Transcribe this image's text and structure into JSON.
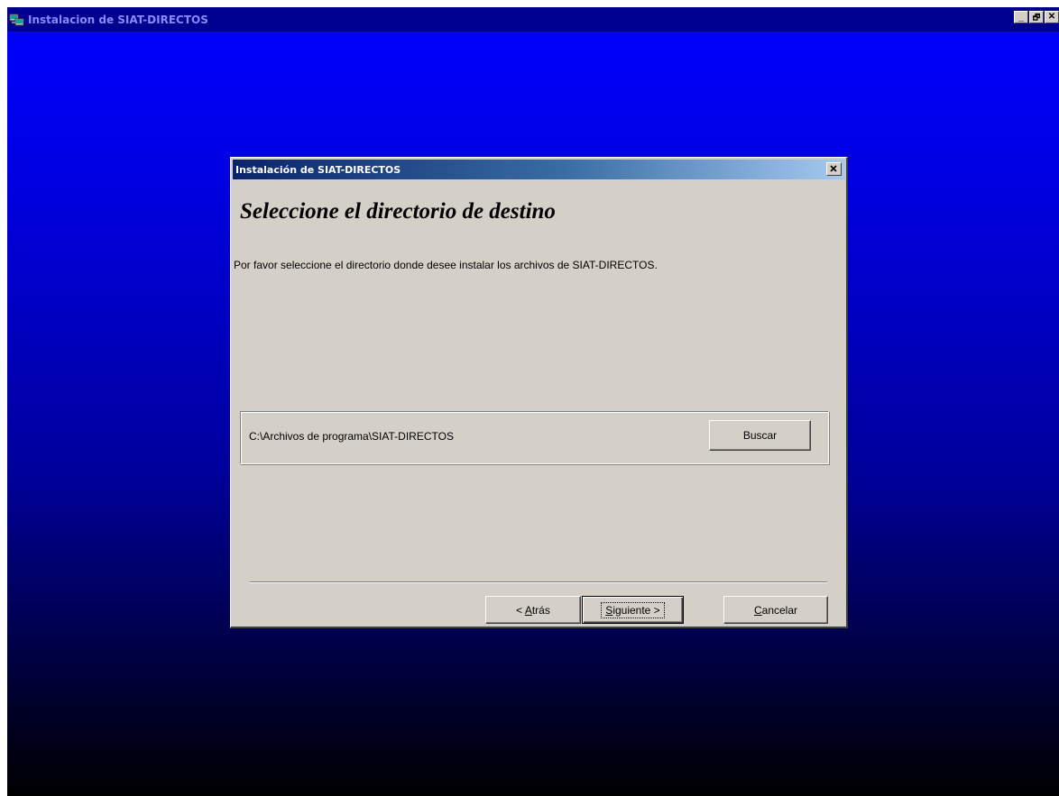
{
  "outer_window": {
    "title": "Instalacion de SIAT-DIRECTOS",
    "controls": {
      "minimize": "_",
      "restore": "🗗",
      "close": "✕"
    }
  },
  "dialog": {
    "title": "Instalación de SIAT-DIRECTOS",
    "close_glyph": "✕",
    "heading": "Seleccione el directorio de destino",
    "instructions": "Por favor seleccione el directorio donde desee instalar los archivos de SIAT-DIRECTOS.",
    "destination_path": "C:\\Archivos de programa\\SIAT-DIRECTOS",
    "browse_label": "Buscar",
    "buttons": {
      "back": {
        "prefix": "< ",
        "accel": "A",
        "rest": "trás"
      },
      "next": {
        "accel": "S",
        "rest": "iguiente >"
      },
      "cancel": {
        "accel": "C",
        "rest": "ancelar"
      }
    }
  },
  "colors": {
    "desktop_top": "#0000ff",
    "desktop_bottom": "#000000",
    "dialog_bg": "#d4d0c8",
    "dialog_title_start": "#0a246a",
    "dialog_title_end": "#a6caf0"
  },
  "icons": {
    "app": "installer-icon",
    "close": "close-icon"
  }
}
